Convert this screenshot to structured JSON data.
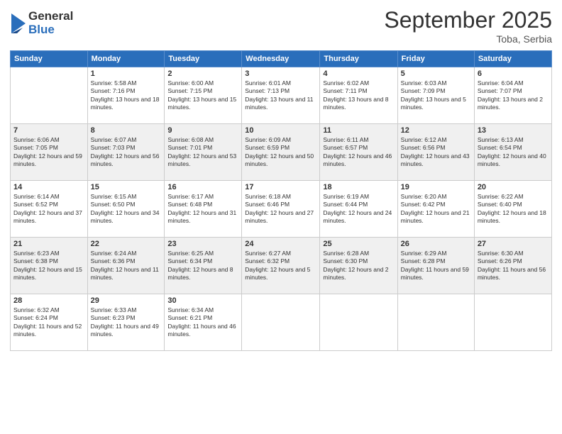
{
  "logo": {
    "general": "General",
    "blue": "Blue"
  },
  "header": {
    "month": "September 2025",
    "location": "Toba, Serbia"
  },
  "weekdays": [
    "Sunday",
    "Monday",
    "Tuesday",
    "Wednesday",
    "Thursday",
    "Friday",
    "Saturday"
  ],
  "weeks": [
    [
      {
        "day": "",
        "sunrise": "",
        "sunset": "",
        "daylight": ""
      },
      {
        "day": "1",
        "sunrise": "Sunrise: 5:58 AM",
        "sunset": "Sunset: 7:16 PM",
        "daylight": "Daylight: 13 hours and 18 minutes."
      },
      {
        "day": "2",
        "sunrise": "Sunrise: 6:00 AM",
        "sunset": "Sunset: 7:15 PM",
        "daylight": "Daylight: 13 hours and 15 minutes."
      },
      {
        "day": "3",
        "sunrise": "Sunrise: 6:01 AM",
        "sunset": "Sunset: 7:13 PM",
        "daylight": "Daylight: 13 hours and 11 minutes."
      },
      {
        "day": "4",
        "sunrise": "Sunrise: 6:02 AM",
        "sunset": "Sunset: 7:11 PM",
        "daylight": "Daylight: 13 hours and 8 minutes."
      },
      {
        "day": "5",
        "sunrise": "Sunrise: 6:03 AM",
        "sunset": "Sunset: 7:09 PM",
        "daylight": "Daylight: 13 hours and 5 minutes."
      },
      {
        "day": "6",
        "sunrise": "Sunrise: 6:04 AM",
        "sunset": "Sunset: 7:07 PM",
        "daylight": "Daylight: 13 hours and 2 minutes."
      }
    ],
    [
      {
        "day": "7",
        "sunrise": "Sunrise: 6:06 AM",
        "sunset": "Sunset: 7:05 PM",
        "daylight": "Daylight: 12 hours and 59 minutes."
      },
      {
        "day": "8",
        "sunrise": "Sunrise: 6:07 AM",
        "sunset": "Sunset: 7:03 PM",
        "daylight": "Daylight: 12 hours and 56 minutes."
      },
      {
        "day": "9",
        "sunrise": "Sunrise: 6:08 AM",
        "sunset": "Sunset: 7:01 PM",
        "daylight": "Daylight: 12 hours and 53 minutes."
      },
      {
        "day": "10",
        "sunrise": "Sunrise: 6:09 AM",
        "sunset": "Sunset: 6:59 PM",
        "daylight": "Daylight: 12 hours and 50 minutes."
      },
      {
        "day": "11",
        "sunrise": "Sunrise: 6:11 AM",
        "sunset": "Sunset: 6:57 PM",
        "daylight": "Daylight: 12 hours and 46 minutes."
      },
      {
        "day": "12",
        "sunrise": "Sunrise: 6:12 AM",
        "sunset": "Sunset: 6:56 PM",
        "daylight": "Daylight: 12 hours and 43 minutes."
      },
      {
        "day": "13",
        "sunrise": "Sunrise: 6:13 AM",
        "sunset": "Sunset: 6:54 PM",
        "daylight": "Daylight: 12 hours and 40 minutes."
      }
    ],
    [
      {
        "day": "14",
        "sunrise": "Sunrise: 6:14 AM",
        "sunset": "Sunset: 6:52 PM",
        "daylight": "Daylight: 12 hours and 37 minutes."
      },
      {
        "day": "15",
        "sunrise": "Sunrise: 6:15 AM",
        "sunset": "Sunset: 6:50 PM",
        "daylight": "Daylight: 12 hours and 34 minutes."
      },
      {
        "day": "16",
        "sunrise": "Sunrise: 6:17 AM",
        "sunset": "Sunset: 6:48 PM",
        "daylight": "Daylight: 12 hours and 31 minutes."
      },
      {
        "day": "17",
        "sunrise": "Sunrise: 6:18 AM",
        "sunset": "Sunset: 6:46 PM",
        "daylight": "Daylight: 12 hours and 27 minutes."
      },
      {
        "day": "18",
        "sunrise": "Sunrise: 6:19 AM",
        "sunset": "Sunset: 6:44 PM",
        "daylight": "Daylight: 12 hours and 24 minutes."
      },
      {
        "day": "19",
        "sunrise": "Sunrise: 6:20 AM",
        "sunset": "Sunset: 6:42 PM",
        "daylight": "Daylight: 12 hours and 21 minutes."
      },
      {
        "day": "20",
        "sunrise": "Sunrise: 6:22 AM",
        "sunset": "Sunset: 6:40 PM",
        "daylight": "Daylight: 12 hours and 18 minutes."
      }
    ],
    [
      {
        "day": "21",
        "sunrise": "Sunrise: 6:23 AM",
        "sunset": "Sunset: 6:38 PM",
        "daylight": "Daylight: 12 hours and 15 minutes."
      },
      {
        "day": "22",
        "sunrise": "Sunrise: 6:24 AM",
        "sunset": "Sunset: 6:36 PM",
        "daylight": "Daylight: 12 hours and 11 minutes."
      },
      {
        "day": "23",
        "sunrise": "Sunrise: 6:25 AM",
        "sunset": "Sunset: 6:34 PM",
        "daylight": "Daylight: 12 hours and 8 minutes."
      },
      {
        "day": "24",
        "sunrise": "Sunrise: 6:27 AM",
        "sunset": "Sunset: 6:32 PM",
        "daylight": "Daylight: 12 hours and 5 minutes."
      },
      {
        "day": "25",
        "sunrise": "Sunrise: 6:28 AM",
        "sunset": "Sunset: 6:30 PM",
        "daylight": "Daylight: 12 hours and 2 minutes."
      },
      {
        "day": "26",
        "sunrise": "Sunrise: 6:29 AM",
        "sunset": "Sunset: 6:28 PM",
        "daylight": "Daylight: 11 hours and 59 minutes."
      },
      {
        "day": "27",
        "sunrise": "Sunrise: 6:30 AM",
        "sunset": "Sunset: 6:26 PM",
        "daylight": "Daylight: 11 hours and 56 minutes."
      }
    ],
    [
      {
        "day": "28",
        "sunrise": "Sunrise: 6:32 AM",
        "sunset": "Sunset: 6:24 PM",
        "daylight": "Daylight: 11 hours and 52 minutes."
      },
      {
        "day": "29",
        "sunrise": "Sunrise: 6:33 AM",
        "sunset": "Sunset: 6:23 PM",
        "daylight": "Daylight: 11 hours and 49 minutes."
      },
      {
        "day": "30",
        "sunrise": "Sunrise: 6:34 AM",
        "sunset": "Sunset: 6:21 PM",
        "daylight": "Daylight: 11 hours and 46 minutes."
      },
      {
        "day": "",
        "sunrise": "",
        "sunset": "",
        "daylight": ""
      },
      {
        "day": "",
        "sunrise": "",
        "sunset": "",
        "daylight": ""
      },
      {
        "day": "",
        "sunrise": "",
        "sunset": "",
        "daylight": ""
      },
      {
        "day": "",
        "sunrise": "",
        "sunset": "",
        "daylight": ""
      }
    ]
  ]
}
